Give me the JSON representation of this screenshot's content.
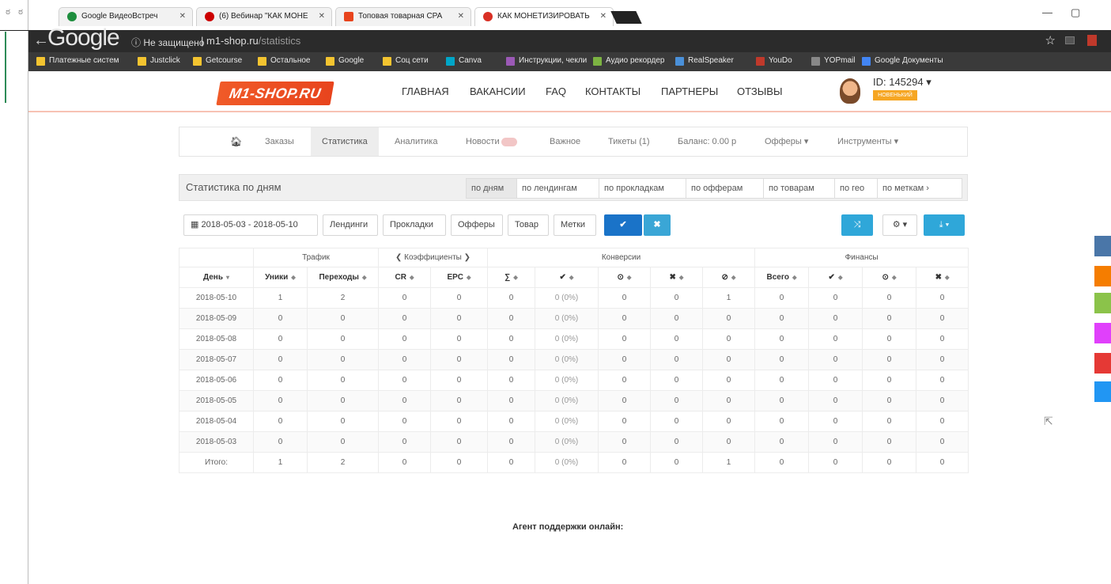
{
  "browser": {
    "tabs": [
      {
        "label": "Google ВидеоВстреч",
        "favicon_color": "#1e8e3e"
      },
      {
        "label": "(6) Вебинар \"КАК МОНЕ",
        "favicon_color": "#cc0000"
      },
      {
        "label": "Топовая товарная CPA",
        "favicon_color": "#e8441d"
      },
      {
        "label": "КАК МОНЕТИЗИРОВАТЬ",
        "favicon_color": "#d93025"
      }
    ],
    "address": {
      "google": "Google",
      "secure_text": "Не защищено",
      "host": "m1-shop.ru",
      "path": "/statistics"
    },
    "bookmarks": [
      {
        "label": "Платежные систем",
        "color": "#f4c430"
      },
      {
        "label": "Justclick",
        "color": "#f4c430"
      },
      {
        "label": "Getcourse",
        "color": "#f4c430"
      },
      {
        "label": "Остальное",
        "color": "#f4c430"
      },
      {
        "label": "Google",
        "color": "#f4c430"
      },
      {
        "label": "Соц сети",
        "color": "#f4c430"
      },
      {
        "label": "Canva",
        "color": "#00a6c8"
      },
      {
        "label": "Инструкции, чекли",
        "color": "#9b59b6"
      },
      {
        "label": "Аудио рекордер",
        "color": "#7cb342"
      },
      {
        "label": "RealSpeaker",
        "color": "#4a90d9"
      },
      {
        "label": "YouDo",
        "color": "#c0392b"
      },
      {
        "label": "YOPmail",
        "color": "#888888"
      },
      {
        "label": "Google Документы",
        "color": "#4285f4"
      }
    ]
  },
  "site": {
    "logo": "M1-SHOP.RU",
    "nav": [
      "ГЛАВНАЯ",
      "ВАКАНСИИ",
      "FAQ",
      "КОНТАКТЫ",
      "ПАРТНЕРЫ",
      "ОТЗЫВЫ"
    ],
    "user_id": "ID: 145294 ▾",
    "user_badge": "НОВЕНЬКИЙ",
    "accent": "#e8441d"
  },
  "subnav": {
    "items": [
      "Заказы",
      "Статистика",
      "Аналитика",
      "Новости",
      "Важное",
      "Тикеты (1)",
      "Баланс: 0.00 р",
      "Офферы ▾",
      "Инструменты ▾"
    ],
    "active": "Статистика"
  },
  "stats": {
    "title": "Статистика по дням",
    "groupings": [
      "по дням",
      "по лендингам",
      "по прокладкам",
      "по офферам",
      "по товарам",
      "по гео",
      "по меткам ›"
    ],
    "active_grouping": "по дням"
  },
  "toolbar": {
    "date_range": "2018-05-03 - 2018-05-10",
    "filters": [
      "Лендинги",
      "Прокладки",
      "Офферы",
      "Товар",
      "Метки"
    ]
  },
  "table": {
    "groups": {
      "traffic": "Трафик",
      "coeffs": "❮ Коэффициенты ❯",
      "conversions": "Конверсии",
      "finance": "Финансы"
    },
    "columns": [
      "День",
      "Уники",
      "Переходы",
      "CR",
      "EPC",
      "∑",
      "✔",
      "⊙",
      "✖",
      "⊘",
      "Всего",
      "✔",
      "⊙",
      "✖"
    ],
    "rows": [
      [
        "2018-05-10",
        "1",
        "2",
        "0",
        "0",
        "0",
        "0 (0%)",
        "0",
        "0",
        "1",
        "0",
        "0",
        "0",
        "0"
      ],
      [
        "2018-05-09",
        "0",
        "0",
        "0",
        "0",
        "0",
        "0 (0%)",
        "0",
        "0",
        "0",
        "0",
        "0",
        "0",
        "0"
      ],
      [
        "2018-05-08",
        "0",
        "0",
        "0",
        "0",
        "0",
        "0 (0%)",
        "0",
        "0",
        "0",
        "0",
        "0",
        "0",
        "0"
      ],
      [
        "2018-05-07",
        "0",
        "0",
        "0",
        "0",
        "0",
        "0 (0%)",
        "0",
        "0",
        "0",
        "0",
        "0",
        "0",
        "0"
      ],
      [
        "2018-05-06",
        "0",
        "0",
        "0",
        "0",
        "0",
        "0 (0%)",
        "0",
        "0",
        "0",
        "0",
        "0",
        "0",
        "0"
      ],
      [
        "2018-05-05",
        "0",
        "0",
        "0",
        "0",
        "0",
        "0 (0%)",
        "0",
        "0",
        "0",
        "0",
        "0",
        "0",
        "0"
      ],
      [
        "2018-05-04",
        "0",
        "0",
        "0",
        "0",
        "0",
        "0 (0%)",
        "0",
        "0",
        "0",
        "0",
        "0",
        "0",
        "0"
      ],
      [
        "2018-05-03",
        "0",
        "0",
        "0",
        "0",
        "0",
        "0 (0%)",
        "0",
        "0",
        "0",
        "0",
        "0",
        "0",
        "0"
      ],
      [
        "Итого:",
        "1",
        "2",
        "0",
        "0",
        "0",
        "0 (0%)",
        "0",
        "0",
        "1",
        "0",
        "0",
        "0",
        "0"
      ]
    ]
  },
  "support_text": "Агент поддержки онлайн:",
  "social_colors": [
    "#4a76a8",
    "#f57d00",
    "#8bc34a",
    "#e040fb",
    "#e53935",
    "#2196f3"
  ]
}
